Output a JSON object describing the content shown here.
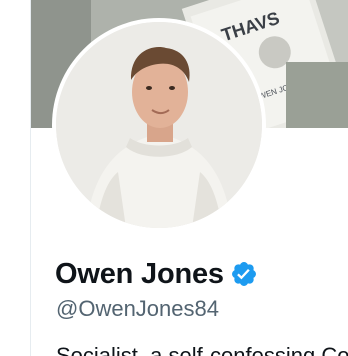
{
  "profile": {
    "banner": {
      "book_cover_text": "THAVS",
      "book_author_text": "OWEN JONES"
    },
    "display_name": "Owen Jones",
    "verified_badge": "verified-check-icon",
    "handle": "@OwenJones84",
    "bio_partial": "Socialist, a self-confessing Corbynite"
  },
  "colors": {
    "name_text": "#0f1419",
    "handle_text": "#536471",
    "verified_blue": "#1d9bf0",
    "border": "#e6ecf0"
  }
}
